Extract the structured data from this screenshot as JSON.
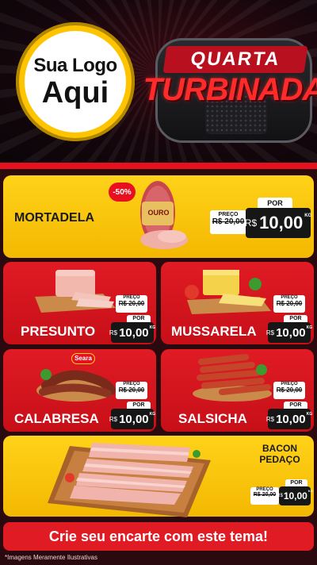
{
  "header": {
    "logo_line1": "Sua Logo",
    "logo_line2": "Aqui",
    "badge_top": "QUARTA",
    "badge_main": "TURBINADA"
  },
  "products": {
    "mortadela": {
      "name": "MORTADELA",
      "discount": "-50%",
      "brand": "OURO",
      "preco_label": "PREÇO",
      "old_price": "R$ 20,00",
      "por_label": "POR",
      "currency": "R$",
      "price": "10,00",
      "unit": "KG"
    },
    "presunto": {
      "name": "PRESUNTO",
      "preco_label": "PREÇO",
      "old_price": "R$ 20,00",
      "por_label": "POR",
      "currency": "R$",
      "price": "10,00",
      "unit": "KG"
    },
    "mussarela": {
      "name": "MUSSARELA",
      "preco_label": "PREÇO",
      "old_price": "R$ 20,00",
      "por_label": "POR",
      "currency": "R$",
      "price": "10,00",
      "unit": "KG"
    },
    "calabresa": {
      "name": "CALABRESA",
      "brand": "Seara",
      "preco_label": "PREÇO",
      "old_price": "R$ 20,00",
      "por_label": "POR",
      "currency": "R$",
      "price": "10,00",
      "unit": "KG"
    },
    "salsicha": {
      "name": "SALSICHA",
      "preco_label": "PREÇO",
      "old_price": "R$ 20,00",
      "por_label": "POR",
      "currency": "R$",
      "price": "10,00",
      "unit": "KG"
    },
    "bacon": {
      "name_line1": "BACON",
      "name_line2": "PEDAÇO",
      "preco_label": "PREÇO",
      "old_price": "R$ 20,00",
      "por_label": "POR",
      "currency": "R$",
      "price": "10,00",
      "unit": "KG"
    }
  },
  "footer": {
    "cta": "Crie seu encarte com este tema!",
    "disclaimer": "*Imagens Meramente Ilustrativas"
  },
  "colors": {
    "brand_red": "#e01b24",
    "brand_yellow": "#ffd21a",
    "dark": "#161616"
  }
}
